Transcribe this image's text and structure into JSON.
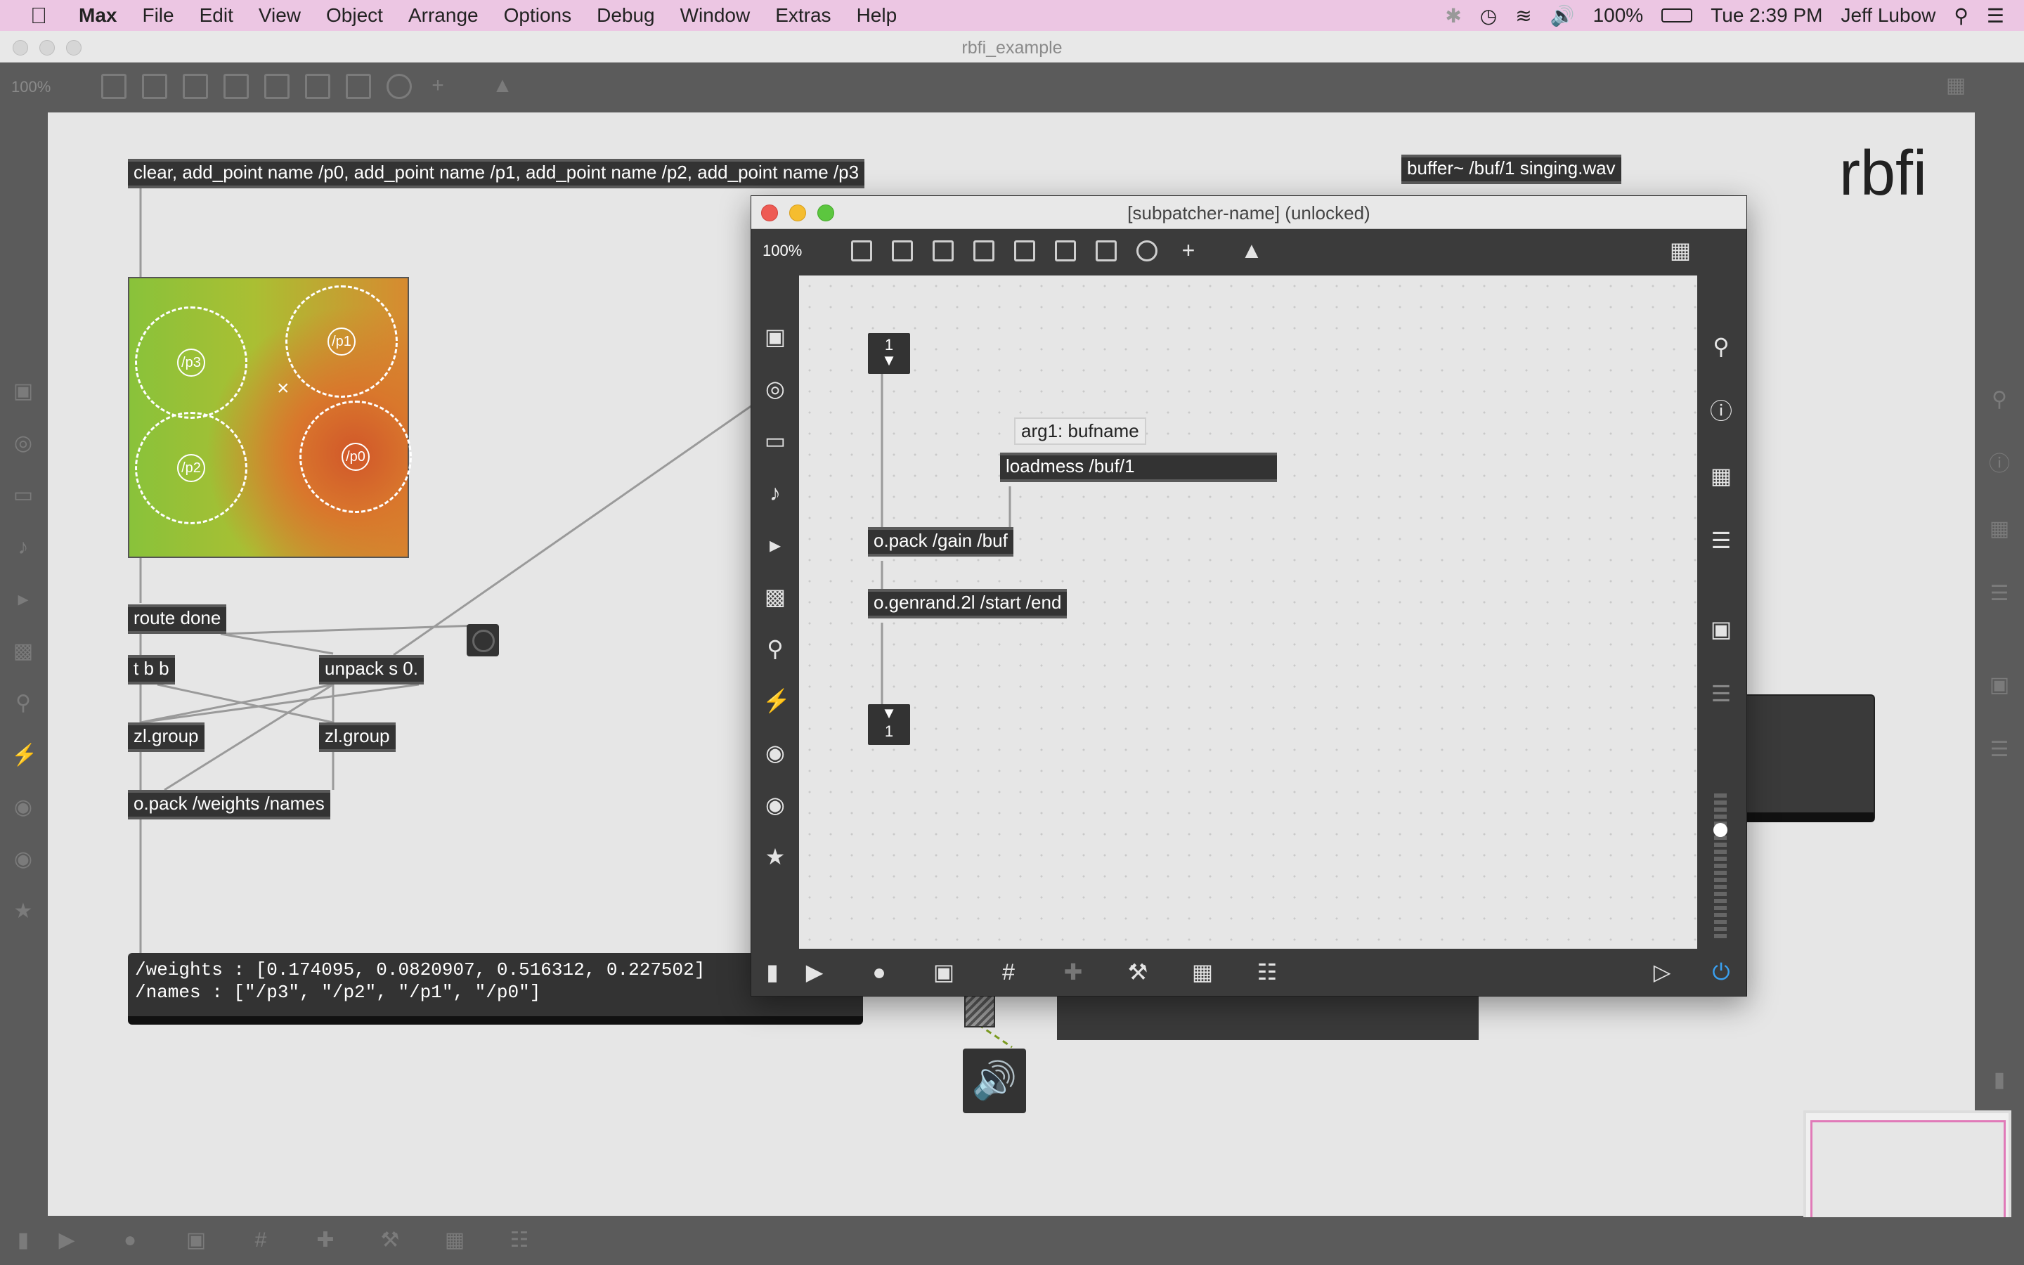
{
  "menubar": {
    "app": "Max",
    "items": [
      "File",
      "Edit",
      "View",
      "Object",
      "Arrange",
      "Options",
      "Debug",
      "Window",
      "Extras",
      "Help"
    ],
    "battery": "100%",
    "clock": "Tue 2:39 PM",
    "user": "Jeff Lubow"
  },
  "window": {
    "title": "rbfi_example",
    "zoom": "100%"
  },
  "patch": {
    "message_clear": "clear, add_point name /p0, add_point name /p1, add_point name /p2, add_point name /p3",
    "buffer": "buffer~ /buf/1 singing.wav",
    "title": "rbfi",
    "route_done": "route done",
    "tbb": "t b b",
    "unpack": "unpack s 0.",
    "zlgroup_1": "zl.group",
    "zlgroup_2": "zl.group",
    "opack_weights": "o.pack /weights /names",
    "print_line1": "/weights : [0.174095, 0.0820907, 0.516312, 0.227502]",
    "print_line2": "/names : [\"/p3\", \"/p2\", \"/p1\", \"/p0\"]",
    "nodes": [
      {
        "label": "/p3"
      },
      {
        "label": "/p1"
      },
      {
        "label": "/p2"
      },
      {
        "label": "/p0"
      }
    ]
  },
  "subpatcher": {
    "title": "[subpatcher-name] (unlocked)",
    "zoom": "100%",
    "inlet_number": "1",
    "outlet_number": "1",
    "tooltip": "arg1: bufname",
    "loadmess": "loadmess /buf/1",
    "opack": "o.pack /gain /buf",
    "genrand": "o.genrand.2l /start /end"
  }
}
